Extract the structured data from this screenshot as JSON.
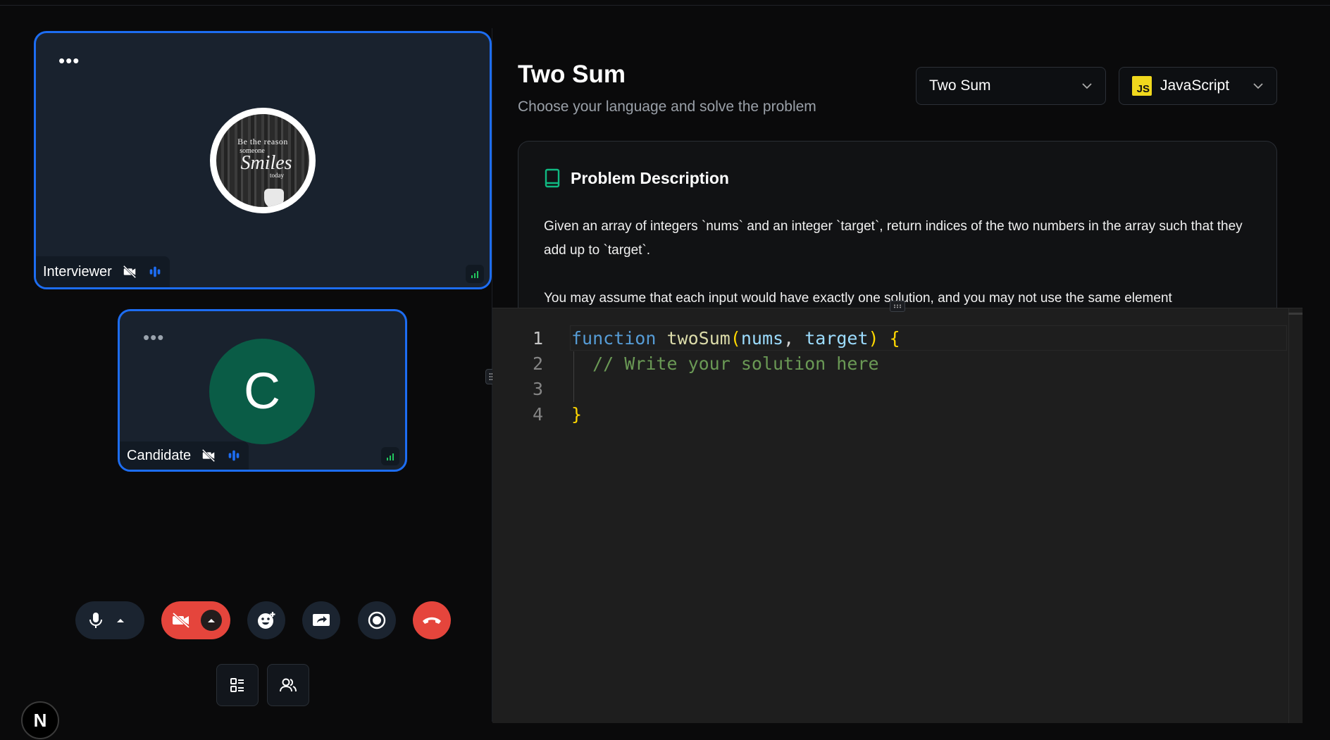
{
  "participants": {
    "interviewer": {
      "name": "Interviewer",
      "avatar_lines": [
        "Be the reason",
        "someone",
        "Smiles",
        "today"
      ]
    },
    "candidate": {
      "name": "Candidate",
      "initial": "C",
      "avatar_color": "#0a5c46"
    }
  },
  "controls": {
    "mic": "mic-icon",
    "camera": "camera-off-icon",
    "reactions": "emoji-icon",
    "share": "screen-share-icon",
    "record": "record-icon",
    "leave": "hang-up-icon",
    "layout": "layout-list-icon",
    "people": "people-icon"
  },
  "app_logo": "N",
  "problem": {
    "title": "Two Sum",
    "subtitle": "Choose your language and solve the problem",
    "selected_problem": "Two Sum",
    "selected_language": "JavaScript",
    "language_badge": "JS",
    "description_heading": "Problem Description",
    "description_paragraphs": [
      "Given an array of integers `nums` and an integer `target`, return indices of the two numbers in the array such that they add up to `target`.",
      "You may assume that each input would have exactly one solution, and you may not use the same element"
    ]
  },
  "editor": {
    "line_numbers": [
      "1",
      "2",
      "3",
      "4"
    ],
    "line1": {
      "kw": "function",
      "fn": "twoSum",
      "open": "(",
      "p1": "nums",
      "comma": ", ",
      "p2": "target",
      "close": ")",
      "brace": "{"
    },
    "line2": "// Write your solution here",
    "line4": "}"
  },
  "colors": {
    "accent": "#1d6df2",
    "danger": "#e5453c",
    "success": "#22c55e",
    "book_icon": "#10b981"
  }
}
